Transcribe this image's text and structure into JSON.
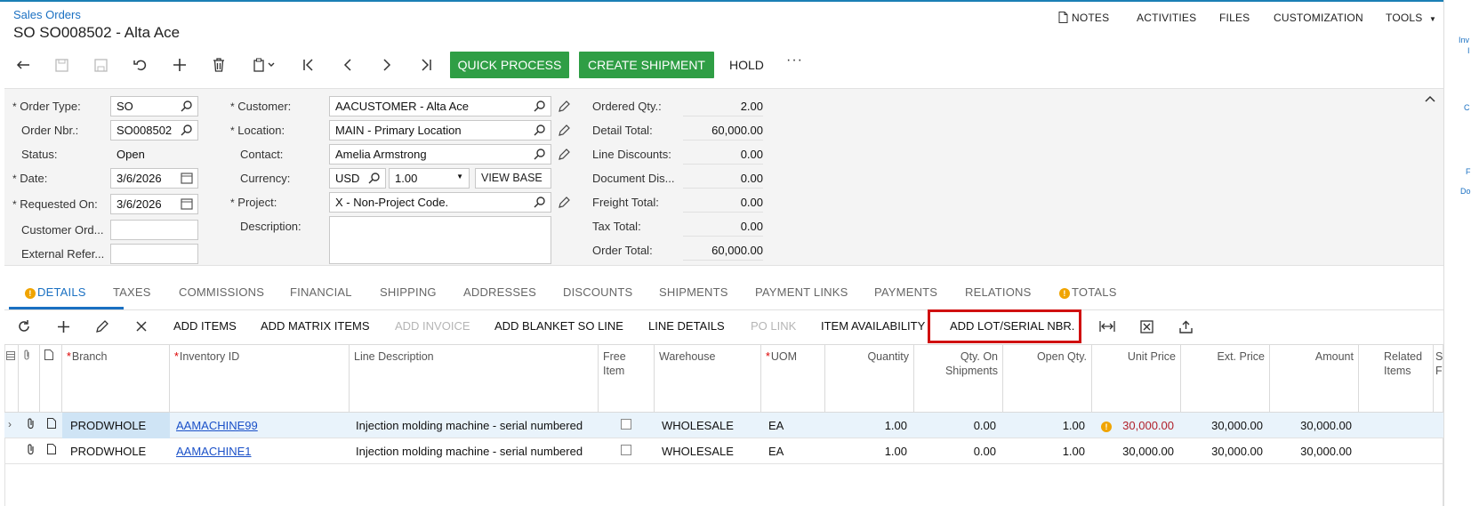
{
  "breadcrumb": "Sales Orders",
  "page_title": "SO SO008502 - Alta Ace",
  "top_nav": [
    "NOTES",
    "ACTIVITIES",
    "FILES",
    "CUSTOMIZATION",
    "TOOLS"
  ],
  "toolbar": {
    "quick_process": "QUICK PROCESS",
    "create_shipment": "CREATE SHIPMENT",
    "hold": "HOLD",
    "more": "···"
  },
  "form": {
    "order_type_label": "Order Type:",
    "order_type": "SO",
    "order_nbr_label": "Order Nbr.:",
    "order_nbr": "SO008502",
    "status_label": "Status:",
    "status": "Open",
    "date_label": "Date:",
    "date": "3/6/2026",
    "requested_on_label": "Requested On:",
    "requested_on": "3/6/2026",
    "customer_ord_label": "Customer Ord...",
    "customer_ord": "",
    "external_ref_label": "External Refer...",
    "external_ref": "",
    "customer_label": "Customer:",
    "customer": "AACUSTOMER - Alta Ace",
    "location_label": "Location:",
    "location": "MAIN - Primary Location",
    "contact_label": "Contact:",
    "contact": "Amelia Armstrong",
    "currency_label": "Currency:",
    "currency": "USD",
    "rate": "1.00",
    "view_base": "VIEW BASE",
    "project_label": "Project:",
    "project": "X - Non-Project Code.",
    "description_label": "Description:",
    "description": "",
    "ordered_qty_label": "Ordered Qty.:",
    "ordered_qty": "2.00",
    "detail_total_label": "Detail Total:",
    "detail_total": "60,000.00",
    "line_discounts_label": "Line Discounts:",
    "line_discounts": "0.00",
    "document_dis_label": "Document Dis...",
    "document_dis": "0.00",
    "freight_total_label": "Freight Total:",
    "freight_total": "0.00",
    "tax_total_label": "Tax Total:",
    "tax_total": "0.00",
    "order_total_label": "Order Total:",
    "order_total": "60,000.00"
  },
  "tabs": [
    "DETAILS",
    "TAXES",
    "COMMISSIONS",
    "FINANCIAL",
    "SHIPPING",
    "ADDRESSES",
    "DISCOUNTS",
    "SHIPMENTS",
    "PAYMENT LINKS",
    "PAYMENTS",
    "RELATIONS",
    "TOTALS"
  ],
  "grid_toolbar": {
    "add_items": "ADD ITEMS",
    "add_matrix_items": "ADD MATRIX ITEMS",
    "add_invoice": "ADD INVOICE",
    "add_blanket": "ADD BLANKET SO LINE",
    "line_details": "LINE DETAILS",
    "po_link": "PO LINK",
    "item_availability": "ITEM AVAILABILITY",
    "add_lot_serial": "ADD LOT/SERIAL NBR."
  },
  "columns": {
    "branch": "Branch",
    "inventory_id": "Inventory ID",
    "line_description": "Line Description",
    "free_item_1": "Free",
    "free_item_2": "Item",
    "warehouse": "Warehouse",
    "uom": "UOM",
    "quantity": "Quantity",
    "qty_on_ship_1": "Qty. On",
    "qty_on_ship_2": "Shipments",
    "open_qty": "Open Qty.",
    "unit_price": "Unit Price",
    "ext_price": "Ext. Price",
    "amount": "Amount",
    "related_1": "Related",
    "related_2": "Items",
    "cut_1": "S",
    "cut_2": "F"
  },
  "rows": [
    {
      "branch": "PRODWHOLE",
      "inventory_id": "AAMACHINE99",
      "description": "Injection molding machine - serial numbered",
      "warehouse": "WHOLESALE",
      "uom": "EA",
      "quantity": "1.00",
      "qty_on_shipments": "0.00",
      "open_qty": "1.00",
      "unit_price": "30,000.00",
      "ext_price": "30,000.00",
      "amount": "30,000.00"
    },
    {
      "branch": "PRODWHOLE",
      "inventory_id": "AAMACHINE1",
      "description": "Injection molding machine - serial numbered",
      "warehouse": "WHOLESALE",
      "uom": "EA",
      "quantity": "1.00",
      "qty_on_shipments": "0.00",
      "open_qty": "1.00",
      "unit_price": "30,000.00",
      "ext_price": "30,000.00",
      "amount": "30,000.00"
    }
  ],
  "right_panel": [
    "Inv",
    "I",
    "C",
    "F",
    "Do"
  ],
  "colors": {
    "accent": "#1a70c2",
    "green": "#2f9e45",
    "highlight": "#d01010",
    "warning": "#f0a400",
    "price_red": "#b0202a"
  }
}
